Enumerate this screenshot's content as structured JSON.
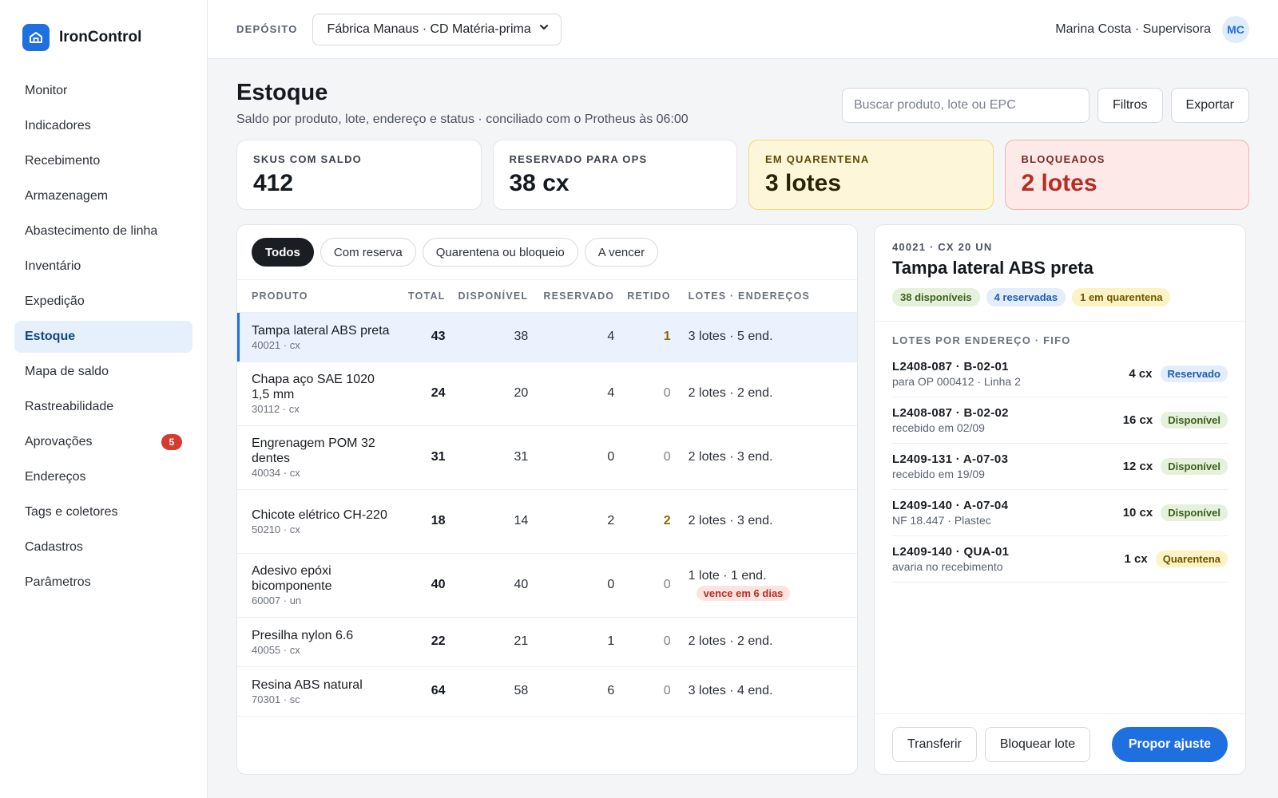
{
  "brand": {
    "name": "IronControl"
  },
  "nav": [
    {
      "label": "Monitor"
    },
    {
      "label": "Indicadores"
    },
    {
      "label": "Recebimento"
    },
    {
      "label": "Armazenagem"
    },
    {
      "label": "Abastecimento de linha"
    },
    {
      "label": "Inventário"
    },
    {
      "label": "Expedição"
    },
    {
      "label": "Estoque",
      "active": true
    },
    {
      "label": "Mapa de saldo"
    },
    {
      "label": "Rastreabilidade"
    },
    {
      "label": "Aprovações",
      "badge": "5"
    },
    {
      "label": "Endereços"
    },
    {
      "label": "Tags e coletores"
    },
    {
      "label": "Cadastros"
    },
    {
      "label": "Parâmetros"
    }
  ],
  "topbar": {
    "deposit_label": "DEPÓSITO",
    "deposit_value": "Fábrica Manaus · CD Matéria-prima",
    "user": "Marina Costa · Supervisora",
    "initials": "MC"
  },
  "page": {
    "title": "Estoque",
    "subtitle": "Saldo por produto, lote, endereço e status · conciliado com o Protheus às 06:00",
    "search_placeholder": "Buscar produto, lote ou EPC",
    "filters_label": "Filtros",
    "export_label": "Exportar"
  },
  "kpis": [
    {
      "label": "SKUS COM SALDO",
      "value": "412",
      "tone": "default"
    },
    {
      "label": "RESERVADO PARA OPS",
      "value": "38 cx",
      "tone": "default"
    },
    {
      "label": "EM QUARENTENA",
      "value": "3 lotes",
      "tone": "warn"
    },
    {
      "label": "BLOQUEADOS",
      "value": "2 lotes",
      "tone": "danger"
    }
  ],
  "chips": [
    {
      "label": "Todos",
      "active": true
    },
    {
      "label": "Com reserva"
    },
    {
      "label": "Quarentena ou bloqueio"
    },
    {
      "label": "A vencer"
    }
  ],
  "table": {
    "columns": [
      "PRODUTO",
      "TOTAL",
      "DISPONÍVEL",
      "RESERVADO",
      "RETIDO",
      "LOTES · ENDEREÇOS"
    ],
    "rows": [
      {
        "name": "Tampa lateral ABS preta",
        "code": "40021 · cx",
        "total": "43",
        "available": "38",
        "reserved": "4",
        "held": "1",
        "lots": "3 lotes · 5 end.",
        "selected": true
      },
      {
        "name": "Chapa aço SAE 1020 1,5 mm",
        "code": "30112 · cx",
        "total": "24",
        "available": "20",
        "reserved": "4",
        "held": "0",
        "lots": "2 lotes · 2 end."
      },
      {
        "name": "Engrenagem POM 32 dentes",
        "code": "40034 · cx",
        "total": "31",
        "available": "31",
        "reserved": "0",
        "held": "0",
        "lots": "2 lotes · 3 end."
      },
      {
        "name": "Chicote elétrico CH-220",
        "code": "50210 · cx",
        "total": "18",
        "available": "14",
        "reserved": "2",
        "held": "2",
        "lots": "2 lotes · 3 end."
      },
      {
        "name": "Adesivo epóxi bicomponente",
        "code": "60007 · un",
        "total": "40",
        "available": "40",
        "reserved": "0",
        "held": "0",
        "lots": "1 lote · 1 end.",
        "expiry": "vence em 6 dias"
      },
      {
        "name": "Presilha nylon 6.6",
        "code": "40055 · cx",
        "total": "22",
        "available": "21",
        "reserved": "1",
        "held": "0",
        "lots": "2 lotes · 2 end."
      },
      {
        "name": "Resina ABS natural",
        "code": "70301 · sc",
        "total": "64",
        "available": "58",
        "reserved": "6",
        "held": "0",
        "lots": "3 lotes · 4 end."
      }
    ]
  },
  "detail": {
    "code": "40021 · CX 20 UN",
    "title": "Tampa lateral ABS preta",
    "pills": [
      {
        "label": "38 disponíveis",
        "tone": "green"
      },
      {
        "label": "4 reservadas",
        "tone": "blue"
      },
      {
        "label": "1 em quarentena",
        "tone": "yellow"
      }
    ],
    "section_label": "LOTES POR ENDEREÇO · FIFO",
    "lots": [
      {
        "id": "L2408-087 · B-02-01",
        "note": "para OP 000412 · Linha 2",
        "qty": "4 cx",
        "status": "Reservado",
        "tone": "res"
      },
      {
        "id": "L2408-087 · B-02-02",
        "note": "recebido em 02/09",
        "qty": "16 cx",
        "status": "Disponível",
        "tone": "disp"
      },
      {
        "id": "L2409-131 · A-07-03",
        "note": "recebido em 19/09",
        "qty": "12 cx",
        "status": "Disponível",
        "tone": "disp"
      },
      {
        "id": "L2409-140 · A-07-04",
        "note": "NF 18.447 · Plastec",
        "qty": "10 cx",
        "status": "Disponível",
        "tone": "disp"
      },
      {
        "id": "L2409-140 · QUA-01",
        "note": "avaria no recebimento",
        "qty": "1 cx",
        "status": "Quarentena",
        "tone": "quar"
      }
    ],
    "actions": {
      "transfer": "Transferir",
      "block": "Bloquear lote",
      "propose": "Propor ajuste"
    }
  },
  "colors": {
    "accent": "#1e6fe0",
    "danger": "#d63b2f",
    "warn": "#fdf6d9"
  },
  "icons": {
    "brand": "warehouse-icon",
    "select": "chevron-down-icon"
  }
}
